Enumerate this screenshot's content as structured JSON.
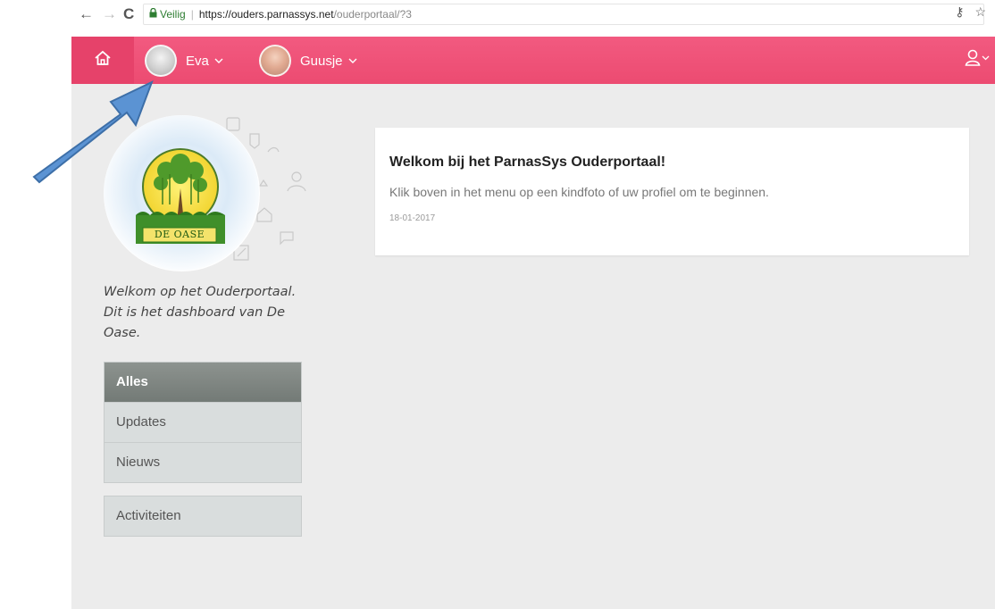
{
  "browser": {
    "back_icon": "←",
    "forward_icon": "→",
    "reload_icon": "C",
    "secure_label": "Veilig",
    "url_host": "https://ouders.parnassys.net",
    "url_path": "/ouderportaal/?3",
    "right_icons": [
      "key-icon",
      "star-icon"
    ]
  },
  "header": {
    "home_icon": "home-icon",
    "children": [
      {
        "name": "Eva",
        "avatar": "avatar-eva"
      },
      {
        "name": "Guusje",
        "avatar": "avatar-guusje"
      }
    ],
    "profile_icon": "user-icon",
    "accent_color": "#ec4b71"
  },
  "sidebar": {
    "logo_text": "DE OASE",
    "welcome_text": "Welkom op het Ouderportaal. Dit is het dashboard van De Oase.",
    "menu_group_1": [
      "Alles",
      "Updates",
      "Nieuws"
    ],
    "menu_group_2": [
      "Activiteiten"
    ],
    "active_item": "Alles"
  },
  "card": {
    "title": "Welkom bij het ParnasSys Ouderportaal!",
    "body": "Klik boven in het menu op een kindfoto of uw profiel om te beginnen.",
    "date": "18-01-2017"
  },
  "annotation": {
    "arrow_color": "#5b93d3"
  }
}
